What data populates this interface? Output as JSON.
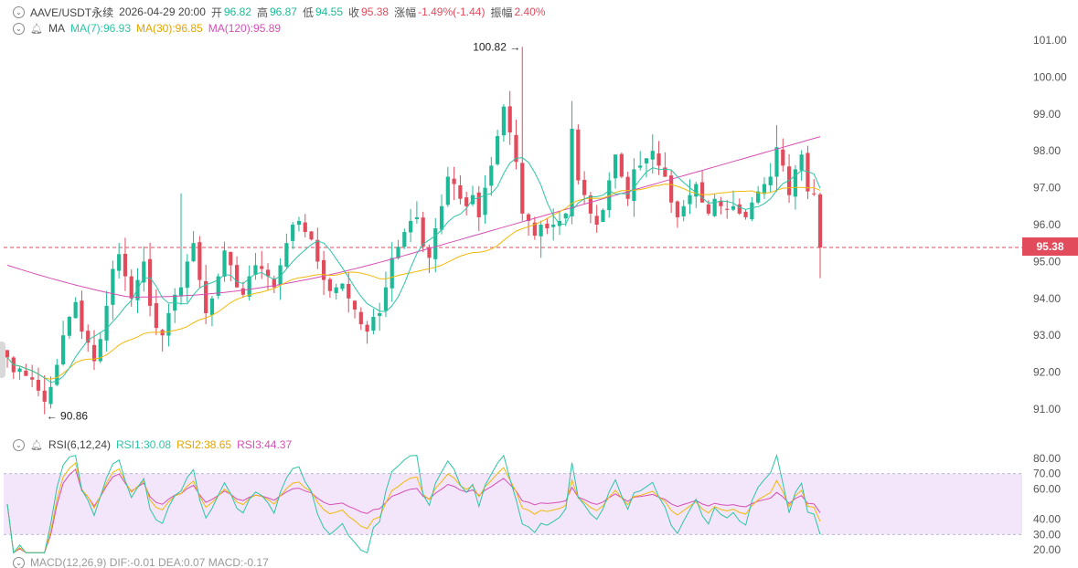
{
  "header": {
    "symbol": "AAVE/USDT永续",
    "datetime": "2026-04-29 20:00",
    "open_label": "开",
    "open": "96.82",
    "high_label": "高",
    "high": "96.87",
    "low_label": "低",
    "low": "94.55",
    "close_label": "收",
    "close": "95.38",
    "change_label": "涨幅",
    "change": "-1.49%(-1.44)",
    "amplitude_label": "振幅",
    "amplitude": "2.40%"
  },
  "ma_legend": {
    "name": "MA",
    "ma7": "MA(7):96.93",
    "ma30": "MA(30):96.85",
    "ma120": "MA(120):95.89"
  },
  "rsi_legend": {
    "name": "RSI(6,12,24)",
    "rsi1": "RSI1:30.08",
    "rsi2": "RSI2:38.65",
    "rsi3": "RSI3:44.37"
  },
  "macd_legend": {
    "text": "MACD(12,26,9)  DIF:-0.01  DEA:0.07  MACD:-0.17"
  },
  "price_tag": "95.38",
  "colors": {
    "up": "#1eb996",
    "down": "#e24b5c",
    "ma7": "#2ec4a6",
    "ma30": "#f0b90b",
    "ma120": "#d64fb4",
    "rsi1": "#2ec4a6",
    "rsi2": "#f0b90b",
    "rsi3": "#d64fb4"
  },
  "chart_data": [
    {
      "type": "candlestick",
      "title": "AAVE/USDT永续",
      "y_ticks": [
        "101.00",
        "100.00",
        "99.00",
        "98.00",
        "97.00",
        "96.00",
        "95.00",
        "94.00",
        "93.00",
        "92.00",
        "91.00"
      ],
      "ylim": [
        90.6,
        101.5
      ],
      "last_price": 95.38,
      "annotations": [
        {
          "text": "100.82",
          "value": 100.82,
          "index": 83,
          "type": "high"
        },
        {
          "text": "90.86",
          "value": 90.86,
          "index": 6,
          "type": "low"
        }
      ],
      "close": [
        92.4,
        92.0,
        92.1,
        91.9,
        91.8,
        91.5,
        91.2,
        91.6,
        92.2,
        93.0,
        93.5,
        93.9,
        93.1,
        92.8,
        92.3,
        92.9,
        93.8,
        94.8,
        95.2,
        94.6,
        94.0,
        94.5,
        95.0,
        93.8,
        93.2,
        93.0,
        93.6,
        94.1,
        94.3,
        95.0,
        95.5,
        94.5,
        93.6,
        94.0,
        94.6,
        95.3,
        94.9,
        94.3,
        94.1,
        94.6,
        94.9,
        94.8,
        94.6,
        94.3,
        94.9,
        95.5,
        96.0,
        96.1,
        95.8,
        95.6,
        95.0,
        94.5,
        94.2,
        94.3,
        94.4,
        94.0,
        93.7,
        93.3,
        93.1,
        93.5,
        93.6,
        94.3,
        95.1,
        95.4,
        95.8,
        96.1,
        96.2,
        95.4,
        95.1,
        95.9,
        96.5,
        97.3,
        97.1,
        96.7,
        96.5,
        96.8,
        96.2,
        97.0,
        97.6,
        98.4,
        99.2,
        98.5,
        97.7,
        96.3,
        96.1,
        95.7,
        96.0,
        95.9,
        96.0,
        96.1,
        96.3,
        98.6,
        97.2,
        96.8,
        96.3,
        96.0,
        96.4,
        97.2,
        97.9,
        97.3,
        96.7,
        97.5,
        97.6,
        97.8,
        98.0,
        97.6,
        97.3,
        96.6,
        96.2,
        96.5,
        96.8,
        97.1,
        96.6,
        96.3,
        96.7,
        96.5,
        96.4,
        96.5,
        96.3,
        96.2,
        96.6,
        96.9,
        97.1,
        97.3,
        98.1,
        97.6,
        96.8,
        97.5,
        97.9,
        96.9,
        96.82,
        95.38
      ],
      "ma7": [],
      "ma30": [],
      "ma120": []
    },
    {
      "type": "line",
      "title": "RSI(6,12,24)",
      "y_ticks": [
        "80.00",
        "70.00",
        "60.00",
        "40.00",
        "30.00",
        "20.00"
      ],
      "ylim": [
        18,
        82
      ],
      "band": [
        30,
        70
      ],
      "series": [
        {
          "name": "RSI1",
          "last": 30.08
        },
        {
          "name": "RSI2",
          "last": 38.65
        },
        {
          "name": "RSI3",
          "last": 44.37
        }
      ]
    }
  ]
}
